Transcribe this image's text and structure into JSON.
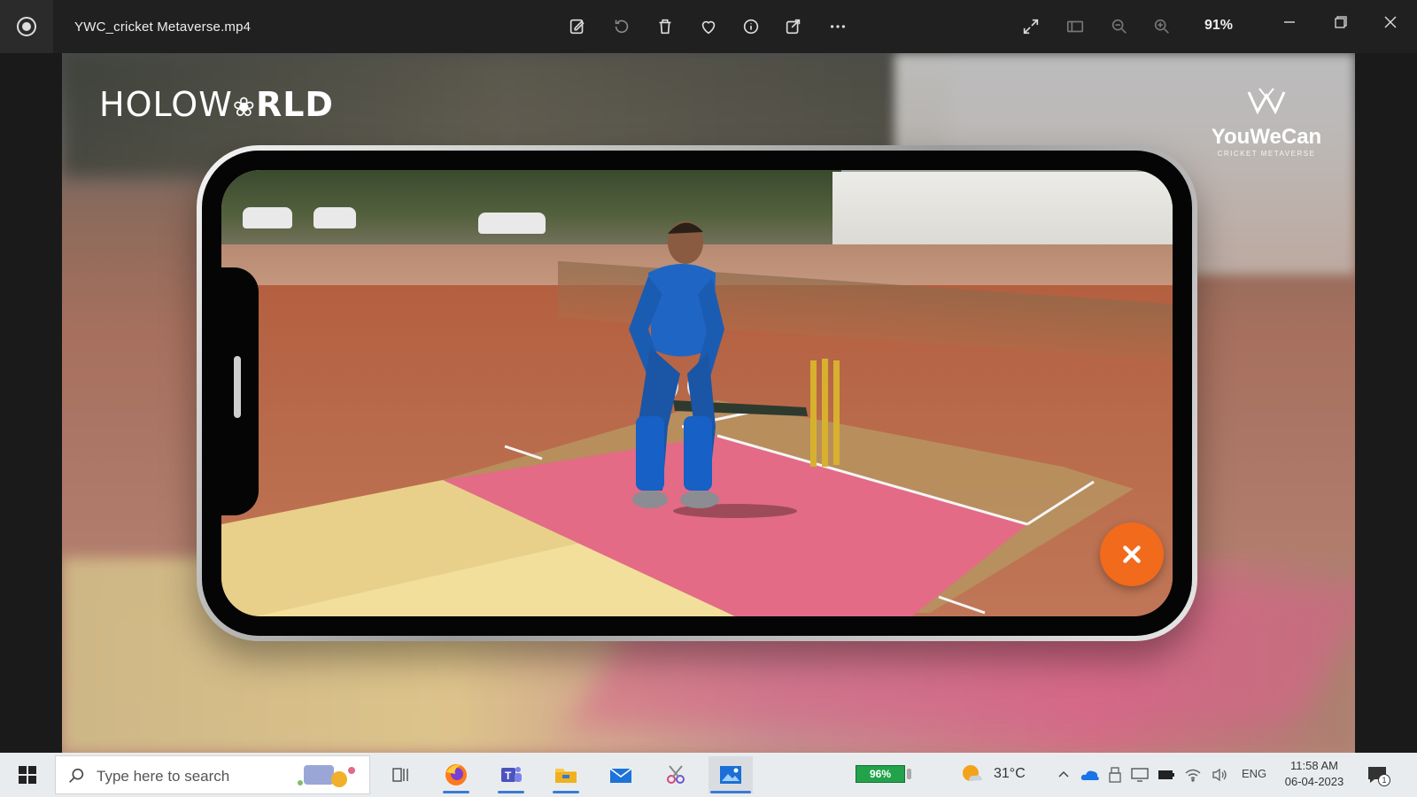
{
  "window": {
    "file_name": "YWC_cricket Metaverse.mp4",
    "zoom": "91%",
    "toolbar_icons": [
      "edit-icon",
      "rotate-icon",
      "delete-icon",
      "favorite-icon",
      "info-icon",
      "share-icon",
      "more-icon"
    ],
    "right_icons": [
      "fullscreen-icon",
      "slideshow-icon",
      "zoom-out-icon",
      "zoom-in-icon"
    ],
    "controls": [
      "minimize",
      "restore",
      "close"
    ]
  },
  "video": {
    "left_logo": "HOLOW",
    "left_logo_mid": "RLD",
    "right_logo_name": "YouWeCan",
    "right_logo_sub": "CRICKET METAVERSE"
  },
  "taskbar": {
    "search_placeholder": "Type here to search",
    "battery": "96%",
    "temperature": "31°C",
    "language": "ENG",
    "time": "11:58 AM",
    "date": "06-04-2023",
    "notification_count": "1",
    "apps": [
      "task-view",
      "firefox",
      "teams",
      "file-explorer",
      "mail",
      "snipping-tool",
      "photos"
    ]
  }
}
